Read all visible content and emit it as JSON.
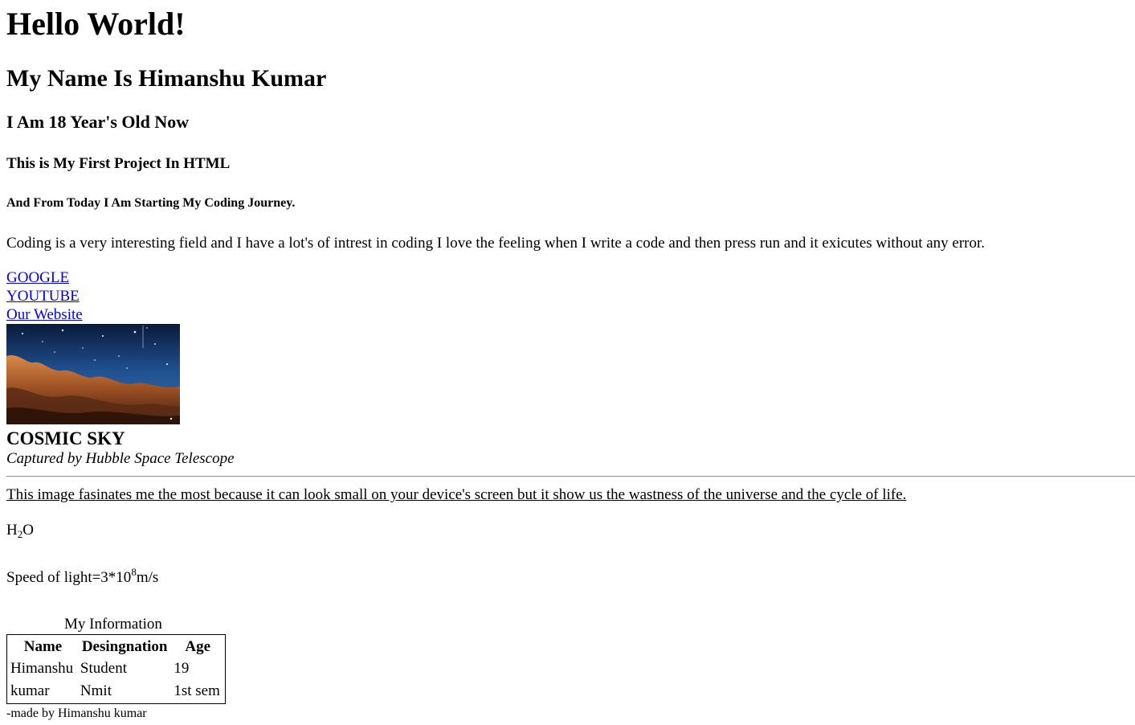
{
  "headings": {
    "h1": "Hello World!",
    "h2": "My Name Is Himanshu Kumar",
    "h3": "I Am 18 Year's Old Now",
    "h4": "This is My First Project In HTML",
    "h5": "And From Today I Am Starting My Coding Journey."
  },
  "intro_paragraph": "Coding is a very interesting field and I have a lot's of intrest in coding I love the feeling when I write a code and then press run and it exicutes without any error.",
  "links": {
    "google": "GOOGLE",
    "youtube": "YOUTUBE",
    "website": "Our Website"
  },
  "figure": {
    "title": "COSMIC SKY",
    "subtitle": "Captured by Hubble Space Telescope"
  },
  "reflection_paragraph": "This image fasinates me the most because it can look small on your device's screen but it show us the wastness of the universe and the cycle of life.",
  "chemistry": {
    "prefix": "H",
    "subscript": "2",
    "suffix": "O"
  },
  "speed_of_light": {
    "prefix": "Speed of light=3*10",
    "superscript": "8",
    "suffix": "m/s"
  },
  "table": {
    "caption": "My Information",
    "headers": [
      "Name",
      "Desingnation",
      "Age"
    ],
    "rows": [
      [
        "Himanshu",
        "Student",
        "19"
      ],
      [
        "kumar",
        "Nmit",
        "1st sem"
      ]
    ]
  },
  "footer": "-made by Himanshu kumar",
  "colors": {
    "link": "#0000ee",
    "text": "#000000",
    "background": "#ffffff"
  }
}
